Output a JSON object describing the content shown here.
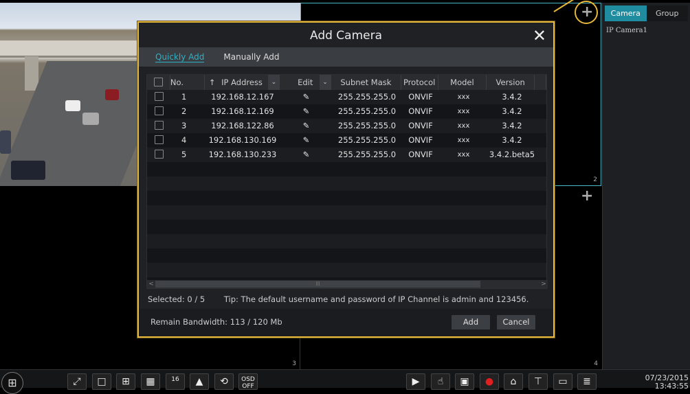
{
  "sidebar": {
    "tabs": [
      {
        "label": "Camera",
        "active": true
      },
      {
        "label": "Group",
        "active": false
      }
    ],
    "items": [
      {
        "label": "IP Camera1"
      }
    ]
  },
  "grid": {
    "cells": [
      {
        "number": "",
        "content": "live video"
      },
      {
        "number": "2",
        "add_icon": "plus-icon"
      },
      {
        "number": "3"
      },
      {
        "number": "4",
        "add_icon": "plus-icon"
      }
    ],
    "plus_glyph": "+"
  },
  "dialog": {
    "title": "Add Camera",
    "close_glyph": "✕",
    "tabs": [
      {
        "label": "Quickly Add",
        "active": true
      },
      {
        "label": "Manually Add",
        "active": false
      }
    ],
    "columns": [
      "No.",
      "IP Address",
      "Edit",
      "Subnet Mask",
      "Protocol",
      "Model",
      "Version"
    ],
    "sort_glyph": "↑",
    "dropdown_glyph": "⌄",
    "rows": [
      {
        "no": "1",
        "ip": "192.168.12.167",
        "mask": "255.255.255.0",
        "protocol": "ONVIF",
        "model": "xxx",
        "version": "3.4.2"
      },
      {
        "no": "2",
        "ip": "192.168.12.169",
        "mask": "255.255.255.0",
        "protocol": "ONVIF",
        "model": "xxx",
        "version": "3.4.2"
      },
      {
        "no": "3",
        "ip": "192.168.122.86",
        "mask": "255.255.255.0",
        "protocol": "ONVIF",
        "model": "xxx",
        "version": "3.4.2"
      },
      {
        "no": "4",
        "ip": "192.168.130.169",
        "mask": "255.255.255.0",
        "protocol": "ONVIF",
        "model": "xxx",
        "version": "3.4.2"
      },
      {
        "no": "5",
        "ip": "192.168.130.233",
        "mask": "255.255.255.0",
        "protocol": "ONVIF",
        "model": "xxx",
        "version": "3.4.2.beta5"
      }
    ],
    "edit_glyph": "✎",
    "selected": "Selected: 0 / 5",
    "tip": "Tip: The default username and password of IP Channel is admin and 123456.",
    "bandwidth": "Remain Bandwidth: 113 / 120 Mb",
    "add_label": "Add",
    "cancel_label": "Cancel",
    "scroll_left": "<",
    "scroll_right": ">",
    "scroll_grip": "|||"
  },
  "taskbar": {
    "left_buttons": [
      {
        "name": "fullscreen",
        "glyph": "⤢"
      },
      {
        "name": "layout-1",
        "glyph": "□"
      },
      {
        "name": "layout-4",
        "glyph": "⊞"
      },
      {
        "name": "layout-9",
        "glyph": "▦"
      },
      {
        "name": "layout-16",
        "glyph": "16"
      },
      {
        "name": "layout-custom",
        "glyph": "▲"
      },
      {
        "name": "sequence",
        "glyph": "⟲"
      },
      {
        "name": "osd",
        "glyph": "OSD OFF"
      }
    ],
    "right_buttons": [
      {
        "name": "playback",
        "glyph": "▶"
      },
      {
        "name": "manual",
        "glyph": "☝"
      },
      {
        "name": "record",
        "glyph": "▣"
      },
      {
        "name": "alarm",
        "glyph": "●"
      },
      {
        "name": "ptz",
        "glyph": "⌂"
      },
      {
        "name": "network",
        "glyph": "⊤"
      },
      {
        "name": "display",
        "glyph": "▭"
      },
      {
        "name": "info",
        "glyph": "≣"
      }
    ],
    "date": "07/23/2015",
    "time": "13:43:55"
  },
  "colors": {
    "accent": "#1f8ca0",
    "highlight": "#e7b93a",
    "selected_cell": "#4bb8c8"
  }
}
